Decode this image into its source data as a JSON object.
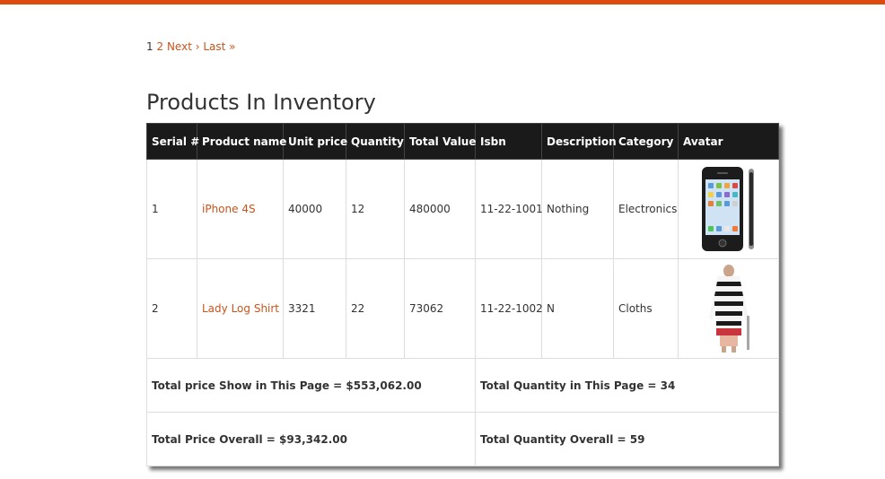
{
  "pager": {
    "current": "1",
    "page2": "2",
    "next": "Next ›",
    "last": "Last »"
  },
  "page_title": "Products In Inventory",
  "table": {
    "headers": [
      "Serial #",
      "Product name",
      "Unit price",
      "Quantity",
      "Total Value",
      "Isbn",
      "Description",
      "Category",
      "Avatar"
    ],
    "rows": [
      {
        "serial": "1",
        "name": "iPhone 4S",
        "unit_price": "40000",
        "quantity": "12",
        "total_value": "480000",
        "isbn": "11-22-1001",
        "description": "Nothing",
        "category": "Electronics",
        "avatar_icon": "phone-image"
      },
      {
        "serial": "2",
        "name": "Lady Log Shirt",
        "unit_price": "3321",
        "quantity": "22",
        "total_value": "73062",
        "isbn": "11-22-1002",
        "description": "N",
        "category": "Cloths",
        "avatar_icon": "shirt-image"
      }
    ],
    "totals": {
      "page_price": "Total price Show in This Page = $553,062.00",
      "page_quantity": "Total Quantity in This Page = 34",
      "overall_price": "Total Price Overall = $93,342.00",
      "overall_quantity": "Total Quantity Overall = 59"
    }
  },
  "colors": {
    "accent": "#dd4b0e",
    "link": "#c9541d",
    "header_bg": "#1a1a1a"
  }
}
